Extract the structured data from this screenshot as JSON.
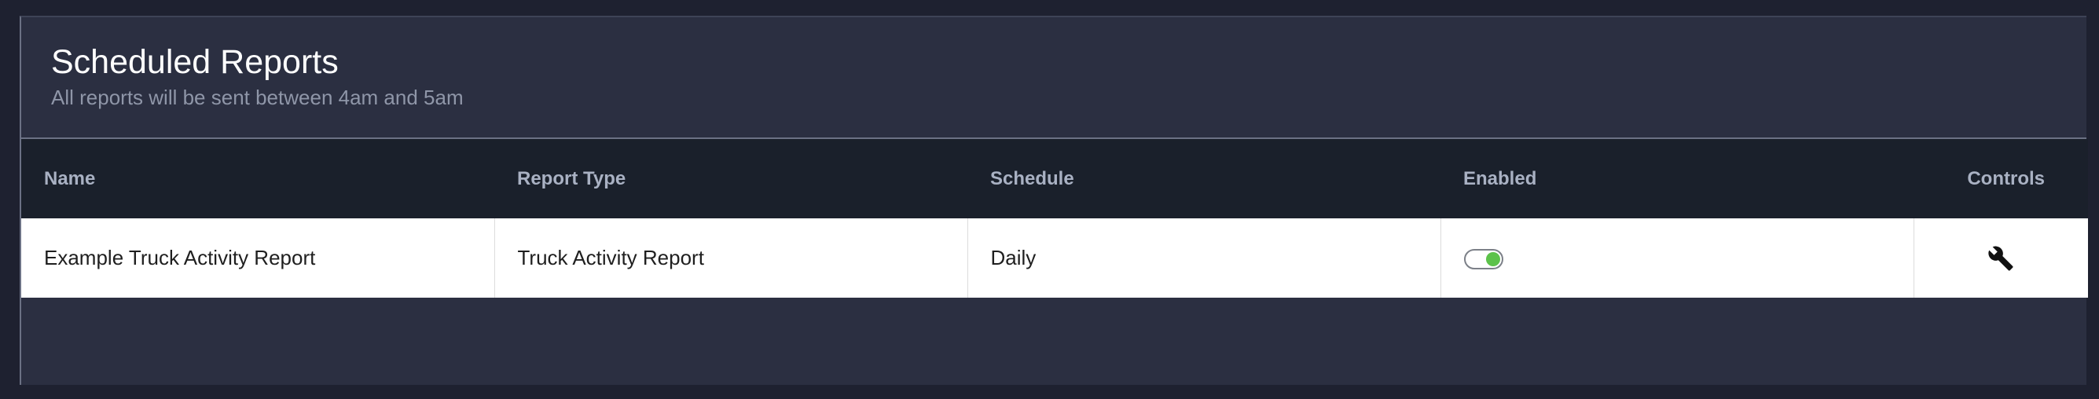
{
  "header": {
    "title": "Scheduled Reports",
    "subtitle": "All reports will be sent between 4am and 5am"
  },
  "table": {
    "columns": [
      "Name",
      "Report Type",
      "Schedule",
      "Enabled",
      "Controls"
    ],
    "rows": [
      {
        "name": "Example Truck Activity Report",
        "report_type": "Truck Activity Report",
        "schedule": "Daily",
        "enabled": true,
        "controls_icon": "wrench-icon"
      }
    ]
  },
  "colors": {
    "toggle_on": "#5cc24a",
    "header_bg": "#1a202b",
    "panel_bg": "#2b2f41"
  }
}
